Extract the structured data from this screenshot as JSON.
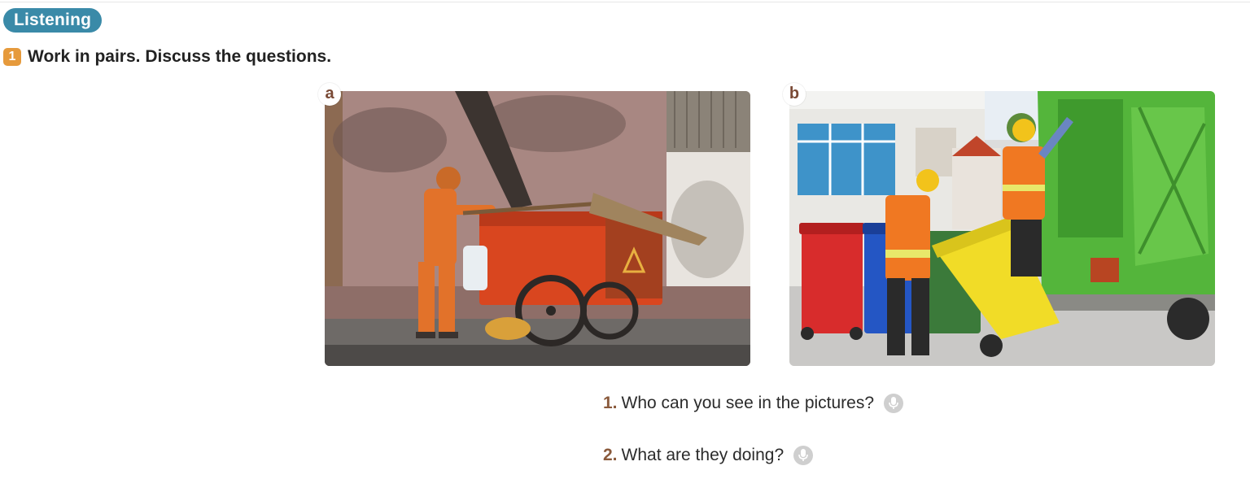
{
  "section_badge": "Listening",
  "exercise": {
    "number": "1",
    "instruction": "Work in pairs. Discuss the questions."
  },
  "photos": [
    {
      "label": "a",
      "icon": "street-sweeper-photo"
    },
    {
      "label": "b",
      "icon": "garbage-collectors-photo"
    }
  ],
  "questions": [
    {
      "number": "1.",
      "text": "Who can you see in the pictures?",
      "icon": "microphone-icon"
    },
    {
      "number": "2.",
      "text": "What are they doing?",
      "icon": "microphone-icon"
    }
  ],
  "colors": {
    "badge": "#3a8aa8",
    "number_box": "#e69a3c",
    "question_number": "#8a5a3c",
    "mic": "#cfcfcf"
  }
}
